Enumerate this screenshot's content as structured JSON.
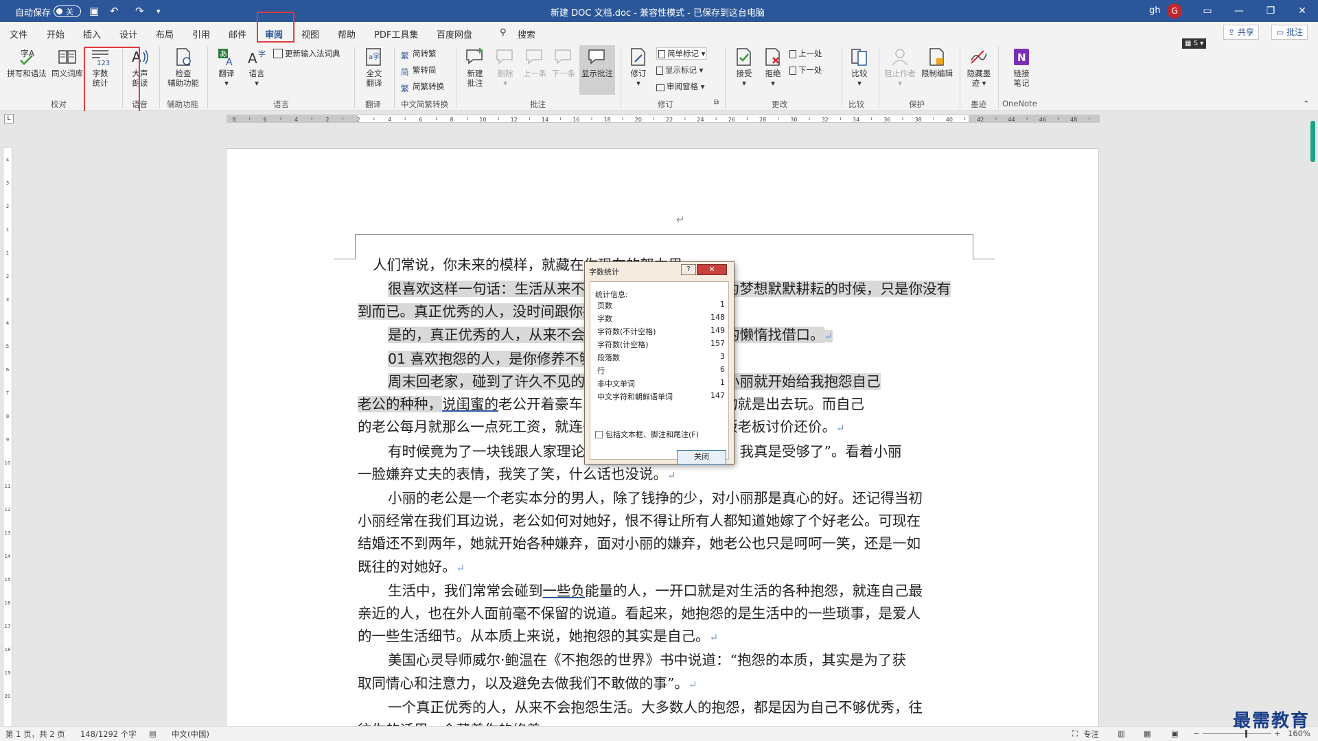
{
  "titlebar": {
    "autosave_label": "自动保存",
    "autosave_state": "关",
    "doc_title": "新建 DOC 文档.doc  -  兼容性模式 - 已保存到这台电脑",
    "user_name": "gh",
    "avatar_letter": "G"
  },
  "menu": {
    "tabs": [
      "文件",
      "开始",
      "插入",
      "设计",
      "布局",
      "引用",
      "邮件",
      "审阅",
      "视图",
      "帮助",
      "PDF工具集",
      "百度网盘"
    ],
    "active_tab": "审阅",
    "search_label": "搜索",
    "share_label": "共享",
    "comment_label": "批注"
  },
  "ribbon": {
    "proofing": {
      "spelling": "拼写和语法",
      "thesaurus": "同义词库",
      "wordcount_line1": "字数",
      "wordcount_line2": "统计",
      "group": "校对"
    },
    "speech": {
      "read_line1": "大声",
      "read_line2": "朗读",
      "group": "语音"
    },
    "accessibility": {
      "check_line1": "检查",
      "check_line2": "辅助功能",
      "group": "辅助功能"
    },
    "language": {
      "translate": "翻译",
      "language": "语言",
      "update_ime": "更新输入法词典",
      "group": "语言"
    },
    "translate_group": {
      "fulltext_line1": "全文",
      "fulltext_line2": "翻译",
      "group": "翻译"
    },
    "chinese": {
      "to_traditional": "简转繁",
      "to_simplified": "繁转简",
      "convert": "简繁转换",
      "group": "中文简繁转换"
    },
    "comments": {
      "new_line1": "新建",
      "new_line2": "批注",
      "delete": "删除",
      "prev": "上一条",
      "next": "下一条",
      "show": "显示批注",
      "group": "批注"
    },
    "tracking": {
      "track": "修订",
      "markup": "简单标记",
      "show_markup": "显示标记",
      "pane": "审阅窗格",
      "group": "修订"
    },
    "changes": {
      "accept": "接受",
      "reject": "拒绝",
      "prev": "上一处",
      "next": "下一处",
      "group": "更改"
    },
    "compare": {
      "compare": "比较",
      "group": "比较"
    },
    "protect": {
      "block": "阻止作者",
      "restrict": "限制编辑",
      "group": "保护"
    },
    "ink": {
      "hide_line1": "隐藏墨",
      "hide_line2": "迹",
      "group": "墨迹"
    },
    "onenote": {
      "link_line1": "链接",
      "link_line2": "笔记",
      "group": "OneNote"
    }
  },
  "ruler_ticks": [
    "8",
    "6",
    "4",
    "2",
    "2",
    "4",
    "6",
    "8",
    "10",
    "12",
    "14",
    "16",
    "18",
    "20",
    "22",
    "24",
    "26",
    "28",
    "30",
    "32",
    "34",
    "36",
    "38",
    "40",
    "42",
    "44",
    "46",
    "48"
  ],
  "vruler_ticks": [
    "4",
    "3",
    "2",
    "1",
    "1",
    "2",
    "3",
    "4",
    "5",
    "6",
    "7",
    "8",
    "9",
    "10",
    "11",
    "12",
    "13",
    "14",
    "15",
    "16",
    "17",
    "18",
    "19",
    "20"
  ],
  "document": {
    "header_mark": "↵",
    "para_mark": "↵",
    "p1": "人们常说，你未来的模样，就藏在你现在的努力里。",
    "p2a": "很喜欢这样一句话：生活从来不会亏待努力的人，在你为梦想默默耕耘的时候，只是你没有",
    "p2b": "到而已。真正优秀的人，没时间跟你抱怨。",
    "p3": "是的，真正优秀的人，从来不会抱怨，也从不会为自己的懒惰找借口。",
    "p4_num": "01",
    "p4": "喜欢抱怨的人，是你修养不够",
    "p5a": "周末回老家，碰到了许久不见的小丽，刚聊了两句话，小丽就开始给我抱怨自己",
    "p5b_1": "老公的种种，",
    "p5b_ul": "说闺蜜的",
    "p5b_2": "老公开着豪车，她的闺蜜",
    "p5b_ul2": "每天",
    "p5b_3": "除了购物就是出去玩。而自己",
    "p5c": "的老公每月就那么一点死工资，就连去菜市场买菜还总跟菜贩老板讨价还价。",
    "p6a": "有时候竟为了一块钱跟人家理论半天，真是丢人！阿心，我真是受够了”。看着小丽",
    "p6b": "一脸嫌弃丈夫的表情，我笑了笑，什么话也没说。",
    "p7a": "小丽的老公是一个老实本分的男人，除了钱挣的少，对小丽那是真心的好。还记得当初",
    "p7b": "小丽经常在我们耳边说，老公如何对她好，恨不得让所有人都知道她嫁了个好老公。可现在",
    "p7c": "结婚还不到两年，她就开始各种嫌弃，面对小丽的嫌弃，她老公也只是呵呵一笑，还是一如",
    "p7d": "既往的对她好。",
    "p8a_1": "生活中，我们常常会碰到",
    "p8a_ul": "一些负",
    "p8a_2": "能量的人，一开口就是对生活的各种抱怨，就连自己最",
    "p8b": "亲近的人，也在外人面前毫不保留的说道。看起来，她抱怨的是生活中的一些琐事，是爱人",
    "p8c": "的一些生活细节。从本质上来说，她抱怨的其实是自己。",
    "p9a": "美国心灵导师威尔·鲍温在《不抱怨的世界》书中说道：“抱怨的本质，其实是为了获",
    "p9b": "取同情心和注意力，以及避免去做我们不敢做的事”。",
    "p10a": "一个真正优秀的人，从来不会抱怨生活。大多数人的抱怨，都是因为自己不够优秀，往",
    "p10b": "往你的话里，会藏着你的修养。"
  },
  "dialog": {
    "title": "字数统计",
    "help": "?",
    "close_x": "✕",
    "section": "统计信息:",
    "stats": [
      {
        "label": "页数",
        "value": "1"
      },
      {
        "label": "字数",
        "value": "148"
      },
      {
        "label": "字符数(不计空格)",
        "value": "149"
      },
      {
        "label": "字符数(计空格)",
        "value": "157"
      },
      {
        "label": "段落数",
        "value": "3"
      },
      {
        "label": "行",
        "value": "6"
      },
      {
        "label": "非中文单词",
        "value": "1"
      },
      {
        "label": "中文字符和朝鲜语单词",
        "value": "147"
      }
    ],
    "checkbox_label": "包括文本框、脚注和尾注(F)",
    "close_button": "关闭"
  },
  "statusbar": {
    "page": "第 1 页，共 2 页",
    "words": "148/1292 个字",
    "language": "中文(中国)",
    "focus": "专注",
    "zoom": "160%"
  },
  "watermark": "最需教育",
  "colors": {
    "titlebar": "#2b579a",
    "accent": "#2b579a",
    "highlight_box": "#e23b3b",
    "scroll_thumb": "#18a38a"
  }
}
